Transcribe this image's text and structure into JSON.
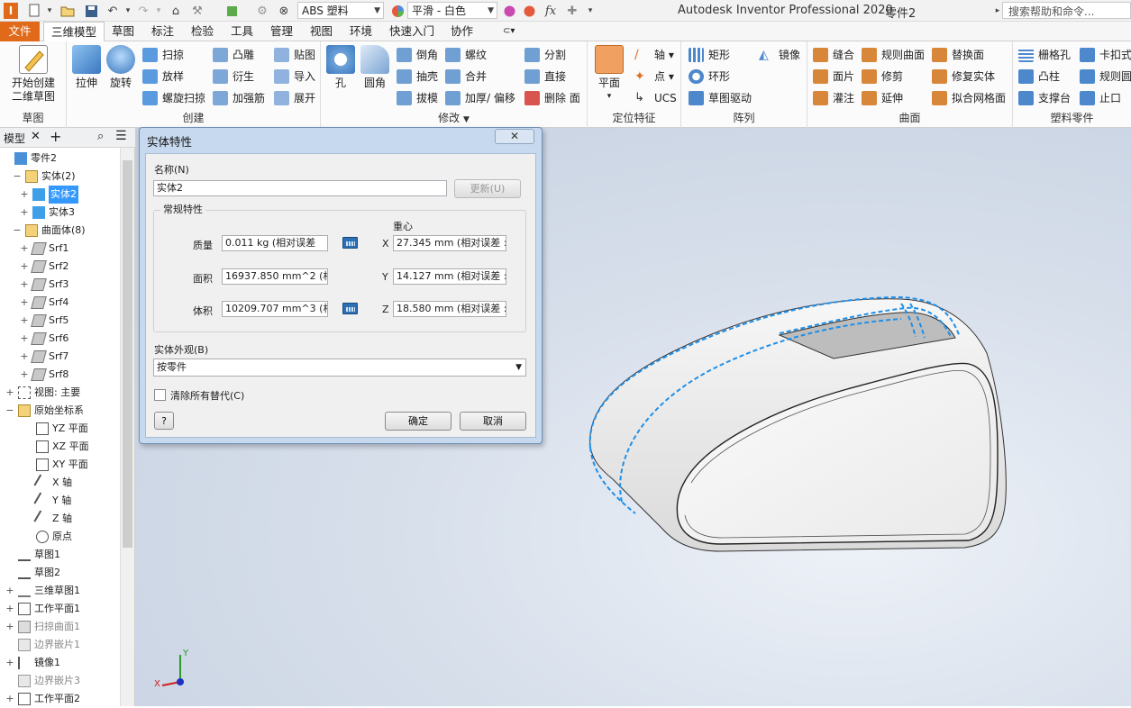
{
  "titlebar": {
    "material": "ABS 塑料",
    "appearance": "平滑 - 白色",
    "app_title": "Autodesk Inventor Professional 2020",
    "doc_title": "零件2",
    "help_search": "搜索帮助和命令..."
  },
  "menu": {
    "file": "文件",
    "tabs": [
      "三维模型",
      "草图",
      "标注",
      "检验",
      "工具",
      "管理",
      "视图",
      "环境",
      "快速入门",
      "协作"
    ]
  },
  "ribbon": {
    "sketch": {
      "start": "开始创建",
      "start2": "二维草图",
      "label": "草图"
    },
    "create": {
      "extrude": "拉伸",
      "revolve": "旋转",
      "sweep": "扫掠",
      "loft": "放样",
      "coil": "螺旋扫掠",
      "emboss": "凸雕",
      "derive": "衍生",
      "rib": "加强筋",
      "decal": "贴图",
      "import": "导入",
      "unfold": "展开",
      "label": "创建"
    },
    "modify": {
      "hole": "孔",
      "fillet": "圆角",
      "chamfer": "倒角",
      "shell": "抽壳",
      "draft": "拔模",
      "thread": "螺纹",
      "combine": "合并",
      "thicken": "加厚/ 偏移",
      "split": "分割",
      "direct": "直接",
      "delete_face": "删除 面",
      "label": "修改"
    },
    "work": {
      "plane": "平面",
      "axis": "轴",
      "point": "点",
      "ucs": "UCS",
      "label": "定位特征"
    },
    "pattern": {
      "rect": "矩形",
      "circ": "环形",
      "sketch_driven": "草图驱动",
      "mirror": "镜像",
      "label": "阵列"
    },
    "surface": {
      "stitch": "缝合",
      "ruled": "规则曲面",
      "replace": "替换面",
      "patch": "面片",
      "trim": "修剪",
      "repair": "修复实体",
      "sculpt": "灌注",
      "extend": "延伸",
      "fit_mesh": "拟合网格面",
      "label": "曲面"
    },
    "plastic": {
      "grill": "栅格孔",
      "snap": "卡扣式",
      "boss": "凸柱",
      "rule_fillet": "规则圆",
      "rest": "支撑台",
      "lip": "止口",
      "label": "塑料零件"
    }
  },
  "browser": {
    "tab": "模型",
    "items": [
      {
        "label": "零件2"
      },
      {
        "label": "实体(2)"
      },
      {
        "label": "实体2"
      },
      {
        "label": "实体3"
      },
      {
        "label": "曲面体(8)"
      },
      {
        "label": "Srf1"
      },
      {
        "label": "Srf2"
      },
      {
        "label": "Srf3"
      },
      {
        "label": "Srf4"
      },
      {
        "label": "Srf5"
      },
      {
        "label": "Srf6"
      },
      {
        "label": "Srf7"
      },
      {
        "label": "Srf8"
      },
      {
        "label": "视图: 主要"
      },
      {
        "label": "原始坐标系"
      },
      {
        "label": "YZ 平面"
      },
      {
        "label": "XZ 平面"
      },
      {
        "label": "XY 平面"
      },
      {
        "label": "X 轴"
      },
      {
        "label": "Y 轴"
      },
      {
        "label": "Z 轴"
      },
      {
        "label": "原点"
      },
      {
        "label": "草图1"
      },
      {
        "label": "草图2"
      },
      {
        "label": "三维草图1"
      },
      {
        "label": "工作平面1"
      },
      {
        "label": "扫掠曲面1"
      },
      {
        "label": "边界嵌片1"
      },
      {
        "label": "镜像1"
      },
      {
        "label": "边界嵌片3"
      },
      {
        "label": "工作平面2"
      }
    ]
  },
  "dialog": {
    "title": "实体特性",
    "close": "✕",
    "name_label": "名称(N)",
    "name_value": "实体2",
    "update": "更新(U)",
    "general": "常规特性",
    "centroid": "重心",
    "mass_label": "质量",
    "mass_value": "0.011 kg (相对误差",
    "area_label": "面积",
    "area_value": "16937.850 mm^2 (相对",
    "volume_label": "体积",
    "volume_value": "10209.707 mm^3 (相对",
    "x_label": "X",
    "x_value": "27.345 mm (相对误差 :",
    "y_label": "Y",
    "y_value": "14.127 mm (相对误差 :",
    "z_label": "Z",
    "z_value": "18.580 mm (相对误差 :",
    "appearance_label": "实体外观(B)",
    "appearance_value": "按零件",
    "clear_overrides": "清除所有替代(C)",
    "ok": "确定",
    "cancel": "取消",
    "help": "?"
  },
  "axis": {
    "x": "X",
    "y": "Y"
  }
}
